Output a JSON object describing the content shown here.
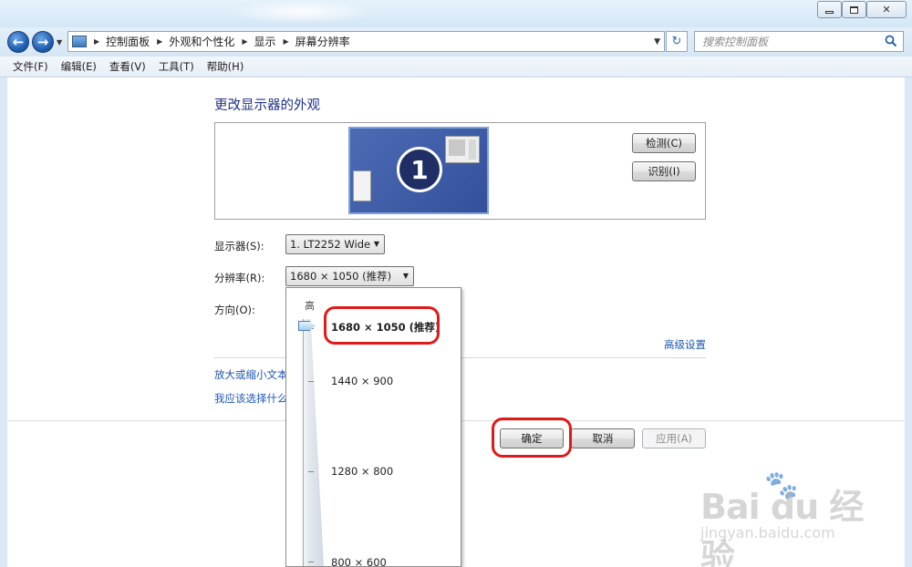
{
  "window": {
    "minimize_glyph": "",
    "maximize_glyph": "",
    "close_glyph": "✕"
  },
  "navigation": {
    "back_glyph": "←",
    "forward_glyph": "→",
    "breadcrumbs": [
      "控制面板",
      "外观和个性化",
      "显示",
      "屏幕分辨率"
    ],
    "refresh_glyph": "↻",
    "search_placeholder": "搜索控制面板"
  },
  "menu": [
    "文件(F)",
    "编辑(E)",
    "查看(V)",
    "工具(T)",
    "帮助(H)"
  ],
  "main": {
    "heading": "更改显示器的外观",
    "monitor_number": "1",
    "detect_button": "检测(C)",
    "identify_button": "识别(I)",
    "display_label": "显示器(S):",
    "display_value": "1. LT2252 Wide",
    "resolution_label": "分辨率(R):",
    "resolution_value": "1680 × 1050 (推荐)",
    "orientation_label": "方向(O):",
    "advanced_link": "高级设置",
    "link_text_size": "放大或缩小文本",
    "link_what_settings": "我应该选择什么",
    "ok_button": "确定",
    "cancel_button": "取消",
    "apply_button": "应用(A)"
  },
  "resolution_popup": {
    "high_label": "高",
    "options": [
      "1680 × 1050 (推荐)",
      "1440 × 900",
      "1280 × 800",
      "800 × 600"
    ],
    "selected_index": 0
  },
  "watermark": {
    "logo": "Bai du 经验",
    "url": "jingyan.baidu.com"
  },
  "colors": {
    "heading": "#1e3287",
    "link": "#1e56b3",
    "highlight_box": "#e01a1a"
  }
}
